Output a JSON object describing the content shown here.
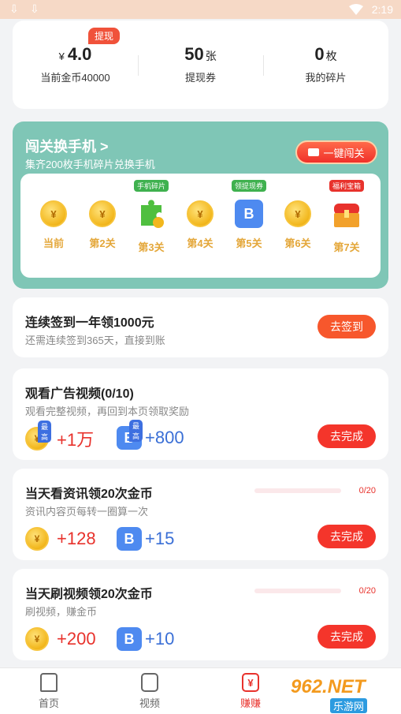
{
  "statusbar": {
    "time": "2:19"
  },
  "stats": {
    "withdraw_badge": "提现",
    "coins_prefix": "¥",
    "coins_value": "4.0",
    "coins_label": "当前金币40000",
    "coupons_value": "50",
    "coupons_unit": "张",
    "coupons_label": "提现券",
    "fragments_value": "0",
    "fragments_unit": "枚",
    "fragments_label": "我的碎片"
  },
  "level_card": {
    "title": "闯关换手机 >",
    "subtitle": "集齐200枚手机碎片兑换手机",
    "button": "一键闯关",
    "stages": [
      {
        "label": "当前",
        "icon": "coin-icon",
        "tag": ""
      },
      {
        "label": "第2关",
        "icon": "coin-icon",
        "tag": ""
      },
      {
        "label": "第3关",
        "icon": "puzzle-icon",
        "tag": "手机碎片"
      },
      {
        "label": "第4关",
        "icon": "coin-icon",
        "tag": ""
      },
      {
        "label": "第5关",
        "icon": "coupon-icon",
        "tag": "领提现券"
      },
      {
        "label": "第6关",
        "icon": "coin-icon",
        "tag": ""
      },
      {
        "label": "第7关",
        "icon": "treasure-chest-icon",
        "tag": "福利宝箱"
      }
    ],
    "colors": {
      "bg": "#7fc6b6",
      "stage_label": "#e4a73a"
    }
  },
  "signin": {
    "title": "连续签到一年领1000元",
    "desc": "还需连续签到365天，直接到账",
    "button": "去签到"
  },
  "tasks": [
    {
      "title": "观看广告视频(0/10)",
      "desc": "观看完整视频，再回到本页领取奖励",
      "coin_reward": "+1万",
      "coin_tag": "最高",
      "coupon_reward": "+800",
      "coupon_tag": "最高",
      "button": "去完成",
      "progress_text": "",
      "progress": 0
    },
    {
      "title": "当天看资讯领20次金币",
      "desc": "资讯内容页每转一圈算一次",
      "coin_reward": "+128",
      "coupon_reward": "+15",
      "button": "去完成",
      "progress_text": "0/20",
      "progress": 0
    },
    {
      "title": "当天刷视频领20次金币",
      "desc": "刷视频，赚金币",
      "coin_reward": "+200",
      "coupon_reward": "+10",
      "button": "去完成",
      "progress_text": "0/20",
      "progress": 0
    }
  ],
  "nav": {
    "items": [
      {
        "label": "首页",
        "icon": "home-icon"
      },
      {
        "label": "视频",
        "icon": "video-icon"
      },
      {
        "label": "赚赚",
        "icon": "earn-icon",
        "active": true
      }
    ],
    "active_glyph": "¥"
  },
  "watermark": {
    "text": "962.NET",
    "sub": "乐游网"
  }
}
